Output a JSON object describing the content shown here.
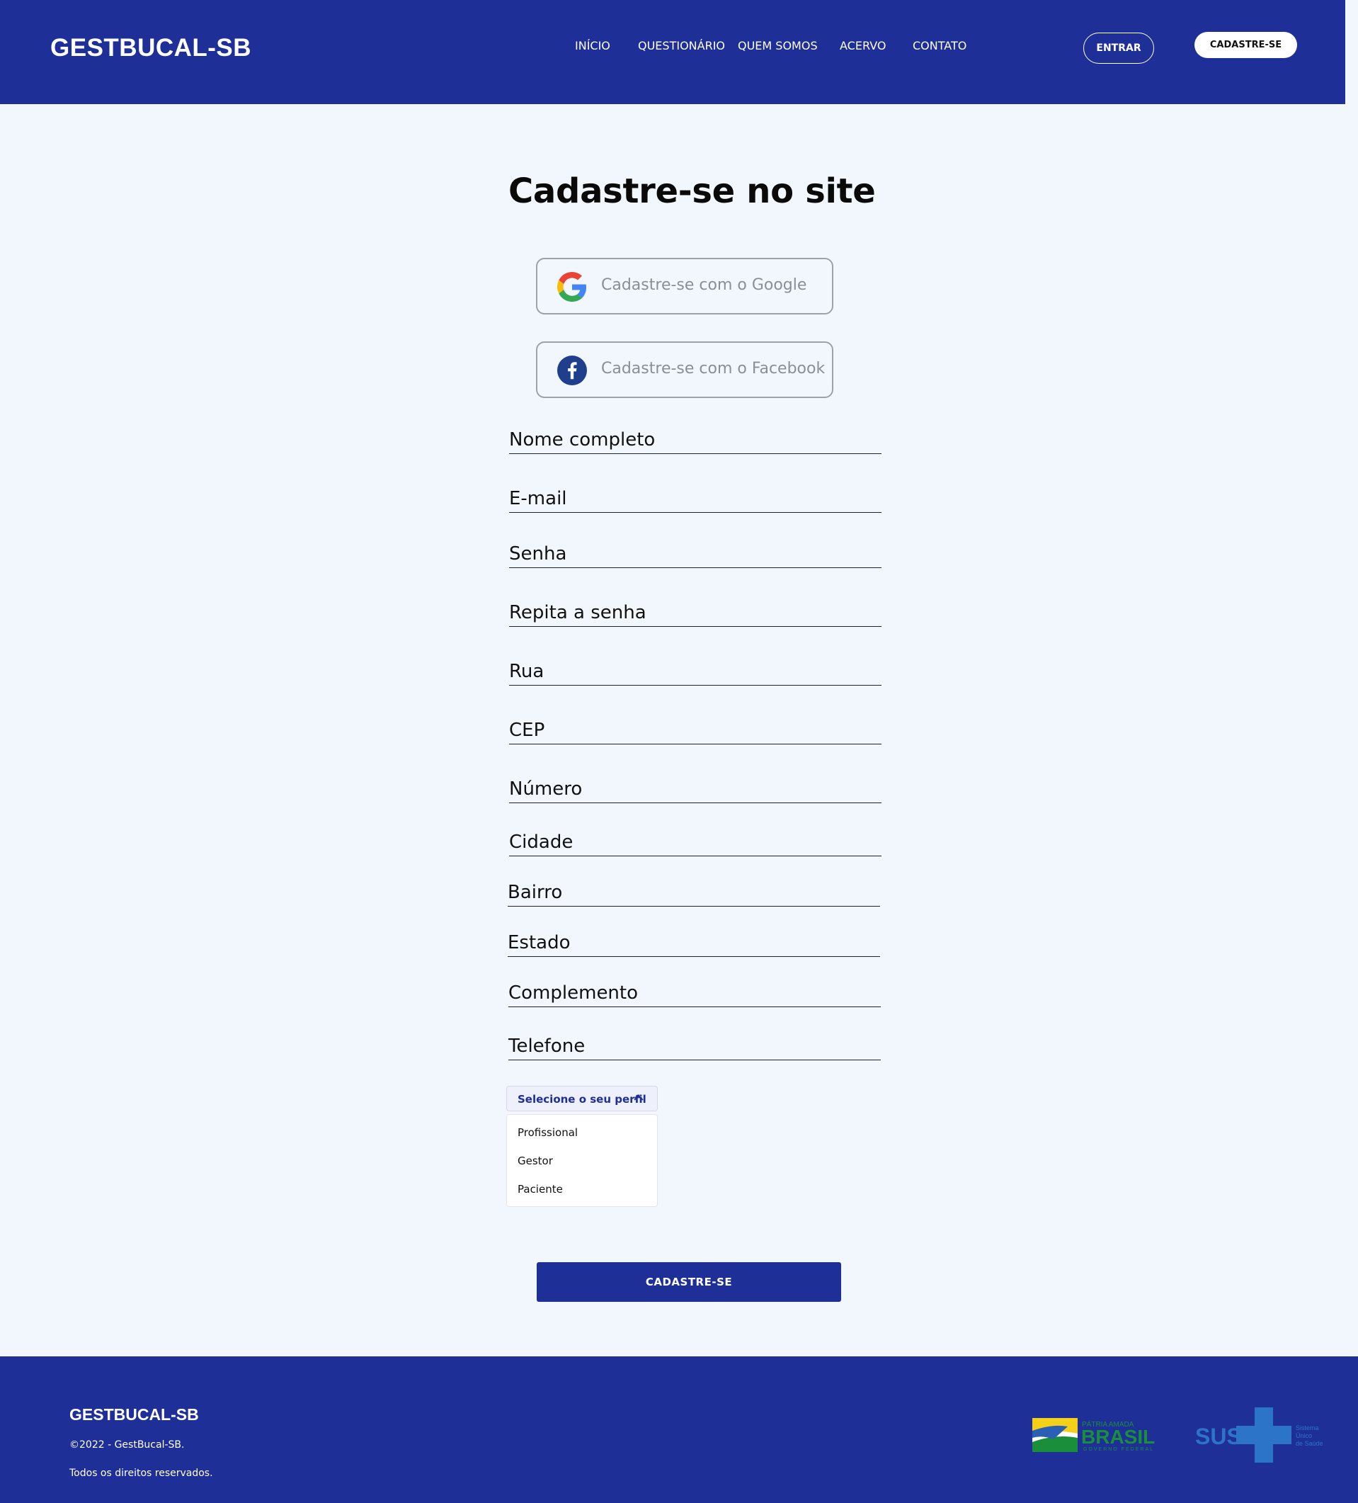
{
  "header": {
    "logo": "GESTBUCAL-SB",
    "nav": [
      "INÍCIO",
      "QUESTIONÁRIO",
      "QUEM SOMOS",
      "ACERVO",
      "CONTATO"
    ],
    "login_label": "ENTRAR",
    "signup_label": "CADASTRE-SE"
  },
  "main": {
    "title": "Cadastre-se no site",
    "google_label": "Cadastre-se com o Google",
    "facebook_label": "Cadastre-se com o Facebook",
    "fields": [
      "Nome completo",
      "E-mail",
      "Senha",
      "Repita a senha",
      "Rua",
      "CEP",
      "Número",
      "Cidade",
      "Bairro",
      "Estado",
      "Complemento",
      "Telefone"
    ],
    "profile_select": {
      "label": "Selecione o seu perfil",
      "options": [
        "Profissional",
        "Gestor",
        "Paciente"
      ]
    },
    "submit_label": "CADASTRE-SE"
  },
  "footer": {
    "logo": "GESTBUCAL-SB",
    "copyright": "©2022 - GestBucal-SB.",
    "rights": "Todos os direitos reservados.",
    "logo1_text": [
      "PÁTRIA AMADA",
      "BRASIL",
      "GOVERNO FEDERAL"
    ],
    "logo2_text": [
      "SUS",
      "Sistema",
      "Único",
      "de Saúde"
    ]
  },
  "colors": {
    "primary": "#1f2f98",
    "background": "#f1f7fd"
  }
}
